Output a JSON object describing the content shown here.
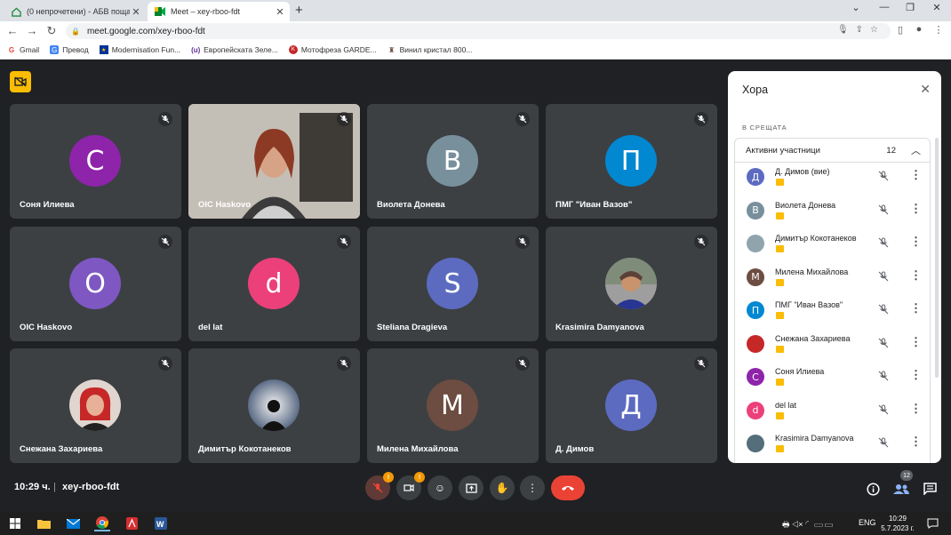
{
  "browser": {
    "tabs": [
      {
        "title": "(0 непрочетени) - АБВ поща",
        "favicon": "home-icon",
        "active": false
      },
      {
        "title": "Meet – xey-rboo-fdt",
        "favicon": "meet-icon",
        "active": true
      }
    ],
    "url": "meet.google.com/xey-rboo-fdt",
    "bookmarks": [
      {
        "label": "Gmail",
        "icon": "gmail-icon"
      },
      {
        "label": "Превод",
        "icon": "translate-icon"
      },
      {
        "label": "Modernisation Fun...",
        "icon": "eu-flag-icon"
      },
      {
        "label": "Европейската Зеле...",
        "icon": "bookmark-icon"
      },
      {
        "label": "Мотофреза GARDE...",
        "icon": "bookmark-icon"
      },
      {
        "label": "Винил кристал 800...",
        "icon": "bookmark-icon"
      }
    ]
  },
  "tiles": [
    {
      "name": "Соня Илиева",
      "initial": "С",
      "color": "#8e24aa",
      "type": "initial"
    },
    {
      "name": "OIC Haskovo",
      "initial": "",
      "color": "",
      "type": "video"
    },
    {
      "name": "Виолета Донева",
      "initial": "В",
      "color": "#78909c",
      "type": "initial"
    },
    {
      "name": "ПМГ \"Иван Вазов\"",
      "initial": "П",
      "color": "#0288d1",
      "type": "initial"
    },
    {
      "name": "OIC Haskovo",
      "initial": "O",
      "color": "#7e57c2",
      "type": "initial"
    },
    {
      "name": "del lat",
      "initial": "d",
      "color": "#ec407a",
      "type": "initial"
    },
    {
      "name": "Steliana Dragieva",
      "initial": "S",
      "color": "#5c6bc0",
      "type": "initial"
    },
    {
      "name": "Krasimira Damyanova",
      "initial": "",
      "color": "",
      "type": "photo"
    },
    {
      "name": "Снежана Захариева",
      "initial": "",
      "color": "",
      "type": "photo"
    },
    {
      "name": "Димитър Кокотанеков",
      "initial": "",
      "color": "",
      "type": "photo"
    },
    {
      "name": "Милена Михайлова",
      "initial": "M",
      "color": "#6d4c41",
      "type": "initial"
    },
    {
      "name": "Д. Димов",
      "initial": "Д",
      "color": "#5c6bc0",
      "type": "initial"
    }
  ],
  "bottombar": {
    "time": "10:29 ч.",
    "separator": "|",
    "meeting_code": "xey-rboo-fdt",
    "mic_badge": "!",
    "cam_badge": "!",
    "participants_count": "12"
  },
  "panel": {
    "title": "Хора",
    "section": "В СРЕЩАТА",
    "group_label": "Активни участници",
    "group_count": "12",
    "participants": [
      {
        "name": "Д. Димов (вие)",
        "initial": "Д",
        "color": "#5c6bc0"
      },
      {
        "name": "Виолета Донева",
        "initial": "В",
        "color": "#78909c"
      },
      {
        "name": "Димитър Кокотанеков",
        "initial": "",
        "color": "#90a4ae"
      },
      {
        "name": "Милена Михайлова",
        "initial": "M",
        "color": "#6d4c41"
      },
      {
        "name": "ПМГ \"Иван Вазов\"",
        "initial": "П",
        "color": "#0288d1"
      },
      {
        "name": "Снежана Захариева",
        "initial": "",
        "color": "#c62828"
      },
      {
        "name": "Соня Илиева",
        "initial": "С",
        "color": "#8e24aa"
      },
      {
        "name": "del lat",
        "initial": "d",
        "color": "#ec407a"
      },
      {
        "name": "Krasimira Damyanova",
        "initial": "",
        "color": "#546e7a"
      }
    ]
  },
  "taskbar": {
    "lang": "ENG",
    "time": "10:29",
    "date": "5.7.2023 г."
  }
}
